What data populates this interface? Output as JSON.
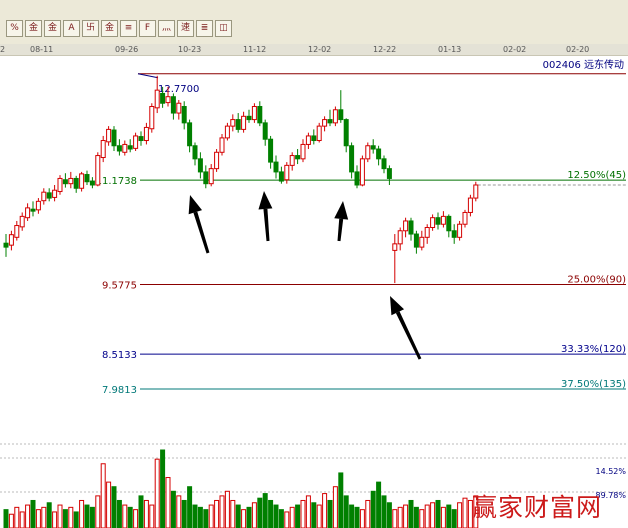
{
  "toolbar": {
    "buttons": [
      {
        "icon": "percent-icon",
        "glyph": "%"
      },
      {
        "icon": "gold-coin-icon",
        "glyph": "金"
      },
      {
        "icon": "gold-list-icon",
        "glyph": "金"
      },
      {
        "icon": "adjust-icon",
        "glyph": "A"
      },
      {
        "icon": "cancel-adjust-icon",
        "glyph": "卐"
      },
      {
        "icon": "gold-info-icon",
        "glyph": "金"
      },
      {
        "icon": "draw-line-icon",
        "glyph": "≡"
      },
      {
        "icon": "finance-f10-icon",
        "glyph": "F"
      },
      {
        "icon": "ma-settings-icon",
        "glyph": "灬"
      },
      {
        "icon": "event-marker-icon",
        "glyph": "速"
      },
      {
        "icon": "stock-list-icon",
        "glyph": "≣"
      },
      {
        "icon": "chart-format-icon",
        "glyph": "◫"
      }
    ]
  },
  "header": {
    "stock_code": "002406",
    "stock_name": "远东传动"
  },
  "watermark": "赢家财富网",
  "colors": {
    "up": "#d40000",
    "down": "#008000",
    "fib_12_5": "#007000",
    "fib_25": "#8b0000",
    "fib_33": "#00008b",
    "fib_37": "#007878",
    "top_line": "#8b0000",
    "arrow": "#000000"
  },
  "chart_data": {
    "type": "candlestick",
    "x_tick_labels": [
      "2",
      "08-11",
      "09-26",
      "10-23",
      "11-12",
      "12-02",
      "12-22",
      "01-13",
      "02-02",
      "02-20"
    ],
    "annotations": {
      "high_label": "12.7700",
      "volume_pct_top": "14.52%",
      "volume_pct_bottom": "89.78%"
    },
    "fibonacci_levels": [
      {
        "price": "11.1738",
        "label": "12.50%(45)",
        "price_value": 11.1738
      },
      {
        "price": "9.5775",
        "label": "25.00%(90)",
        "price_value": 9.5775
      },
      {
        "price": "8.5133",
        "label": "33.33%(120)",
        "price_value": 8.5133
      },
      {
        "price": "7.9813",
        "label": "37.50%(135)",
        "price_value": 7.9813
      }
    ],
    "price_high": 12.77,
    "y_range": [
      7.95,
      12.95
    ],
    "arrows": [
      "10-23",
      "11-12",
      "12-02",
      "12-22"
    ],
    "candles": [
      [
        10.21,
        10.15,
        10.35,
        10.0
      ],
      [
        10.18,
        10.34,
        10.4,
        10.1
      ],
      [
        10.3,
        10.48,
        10.55,
        10.25
      ],
      [
        10.46,
        10.62,
        10.68,
        10.4
      ],
      [
        10.6,
        10.75,
        10.82,
        10.55
      ],
      [
        10.73,
        10.7,
        10.85,
        10.62
      ],
      [
        10.72,
        10.85,
        10.9,
        10.66
      ],
      [
        10.86,
        10.99,
        11.05,
        10.8
      ],
      [
        10.98,
        10.9,
        11.05,
        10.85
      ],
      [
        10.91,
        11.02,
        11.1,
        10.85
      ],
      [
        11.0,
        11.2,
        11.25,
        10.95
      ],
      [
        11.18,
        11.12,
        11.28,
        11.06
      ],
      [
        11.12,
        11.2,
        11.3,
        11.05
      ],
      [
        11.2,
        11.05,
        11.24,
        10.98
      ],
      [
        11.05,
        11.27,
        11.3,
        11.0
      ],
      [
        11.26,
        11.15,
        11.32,
        11.1
      ],
      [
        11.16,
        11.1,
        11.22,
        11.05
      ],
      [
        11.1,
        11.55,
        11.6,
        11.08
      ],
      [
        11.52,
        11.78,
        11.85,
        11.45
      ],
      [
        11.76,
        11.95,
        12.0,
        11.7
      ],
      [
        11.94,
        11.7,
        12.0,
        11.62
      ],
      [
        11.7,
        11.62,
        11.8,
        11.55
      ],
      [
        11.6,
        11.72,
        11.78,
        11.55
      ],
      [
        11.7,
        11.65,
        11.8,
        11.6
      ],
      [
        11.66,
        11.85,
        11.9,
        11.62
      ],
      [
        11.84,
        11.78,
        11.92,
        11.7
      ],
      [
        11.78,
        11.98,
        12.05,
        11.72
      ],
      [
        11.96,
        12.3,
        12.35,
        11.9
      ],
      [
        12.28,
        12.55,
        12.77,
        12.2
      ],
      [
        12.5,
        12.35,
        12.6,
        12.28
      ],
      [
        12.36,
        12.45,
        12.6,
        12.3
      ],
      [
        12.45,
        12.2,
        12.5,
        12.1
      ],
      [
        12.2,
        12.35,
        12.4,
        12.1
      ],
      [
        12.3,
        12.05,
        12.38,
        11.95
      ],
      [
        12.05,
        11.7,
        12.1,
        11.6
      ],
      [
        11.7,
        11.5,
        11.75,
        11.4
      ],
      [
        11.5,
        11.3,
        11.6,
        11.2
      ],
      [
        11.3,
        11.12,
        11.4,
        11.05
      ],
      [
        11.12,
        11.35,
        11.42,
        11.08
      ],
      [
        11.35,
        11.6,
        11.65,
        11.3
      ],
      [
        11.6,
        11.82,
        11.88,
        11.55
      ],
      [
        11.82,
        12.0,
        12.05,
        11.78
      ],
      [
        12.0,
        12.1,
        12.18,
        11.92
      ],
      [
        12.1,
        11.95,
        12.2,
        11.9
      ],
      [
        11.95,
        12.15,
        12.22,
        11.9
      ],
      [
        12.15,
        12.1,
        12.25,
        12.05
      ],
      [
        12.1,
        12.3,
        12.35,
        12.05
      ],
      [
        12.3,
        12.05,
        12.38,
        12.0
      ],
      [
        12.05,
        11.8,
        12.1,
        11.7
      ],
      [
        11.8,
        11.45,
        11.85,
        11.35
      ],
      [
        11.45,
        11.3,
        11.55,
        11.2
      ],
      [
        11.3,
        11.16,
        11.38,
        11.12
      ],
      [
        11.18,
        11.4,
        11.45,
        11.12
      ],
      [
        11.4,
        11.55,
        11.6,
        11.32
      ],
      [
        11.55,
        11.5,
        11.65,
        11.42
      ],
      [
        11.5,
        11.72,
        11.8,
        11.45
      ],
      [
        11.72,
        11.85,
        11.9,
        11.65
      ],
      [
        11.85,
        11.78,
        11.95,
        11.72
      ],
      [
        11.78,
        12.0,
        12.05,
        11.75
      ],
      [
        12.0,
        12.1,
        12.15,
        11.92
      ],
      [
        12.1,
        12.05,
        12.25,
        12.0
      ],
      [
        12.05,
        12.25,
        12.3,
        12.0
      ],
      [
        12.25,
        12.1,
        12.55,
        12.05
      ],
      [
        12.1,
        11.7,
        12.12,
        11.6
      ],
      [
        11.7,
        11.3,
        11.75,
        11.2
      ],
      [
        11.3,
        11.1,
        11.4,
        11.05
      ],
      [
        11.1,
        11.5,
        11.55,
        11.08
      ],
      [
        11.5,
        11.7,
        11.75,
        11.45
      ],
      [
        11.7,
        11.65,
        11.8,
        11.58
      ],
      [
        11.65,
        11.5,
        11.7,
        11.4
      ],
      [
        11.5,
        11.35,
        11.55,
        11.28
      ],
      [
        11.35,
        11.2,
        11.4,
        11.1
      ],
      [
        10.1,
        10.2,
        10.35,
        9.6
      ],
      [
        10.2,
        10.4,
        10.45,
        10.1
      ],
      [
        10.4,
        10.55,
        10.6,
        10.3
      ],
      [
        10.55,
        10.35,
        10.6,
        10.25
      ],
      [
        10.35,
        10.15,
        10.4,
        10.05
      ],
      [
        10.15,
        10.3,
        10.4,
        10.1
      ],
      [
        10.3,
        10.45,
        10.5,
        10.2
      ],
      [
        10.45,
        10.6,
        10.65,
        10.4
      ],
      [
        10.6,
        10.5,
        10.68,
        10.42
      ],
      [
        10.5,
        10.62,
        10.7,
        10.45
      ],
      [
        10.62,
        10.4,
        10.65,
        10.3
      ],
      [
        10.4,
        10.3,
        10.5,
        10.2
      ],
      [
        10.3,
        10.5,
        10.55,
        10.25
      ],
      [
        10.5,
        10.68,
        10.72,
        10.45
      ],
      [
        10.68,
        10.9,
        10.95,
        10.62
      ],
      [
        10.9,
        11.1,
        11.15,
        10.85
      ]
    ],
    "volumes": [
      8,
      6,
      9,
      7,
      10,
      12,
      8,
      9,
      11,
      7,
      10,
      8,
      9,
      7,
      12,
      10,
      9,
      14,
      28,
      20,
      18,
      12,
      10,
      9,
      8,
      14,
      12,
      10,
      30,
      34,
      22,
      16,
      14,
      12,
      18,
      10,
      9,
      8,
      10,
      12,
      14,
      16,
      12,
      10,
      8,
      9,
      11,
      13,
      15,
      12,
      10,
      8,
      7,
      9,
      10,
      12,
      14,
      11,
      10,
      15,
      12,
      18,
      24,
      14,
      10,
      9,
      8,
      12,
      16,
      20,
      14,
      11,
      8,
      9,
      10,
      12,
      9,
      8,
      10,
      11,
      12,
      9,
      10,
      8,
      11,
      13,
      12,
      14
    ]
  }
}
